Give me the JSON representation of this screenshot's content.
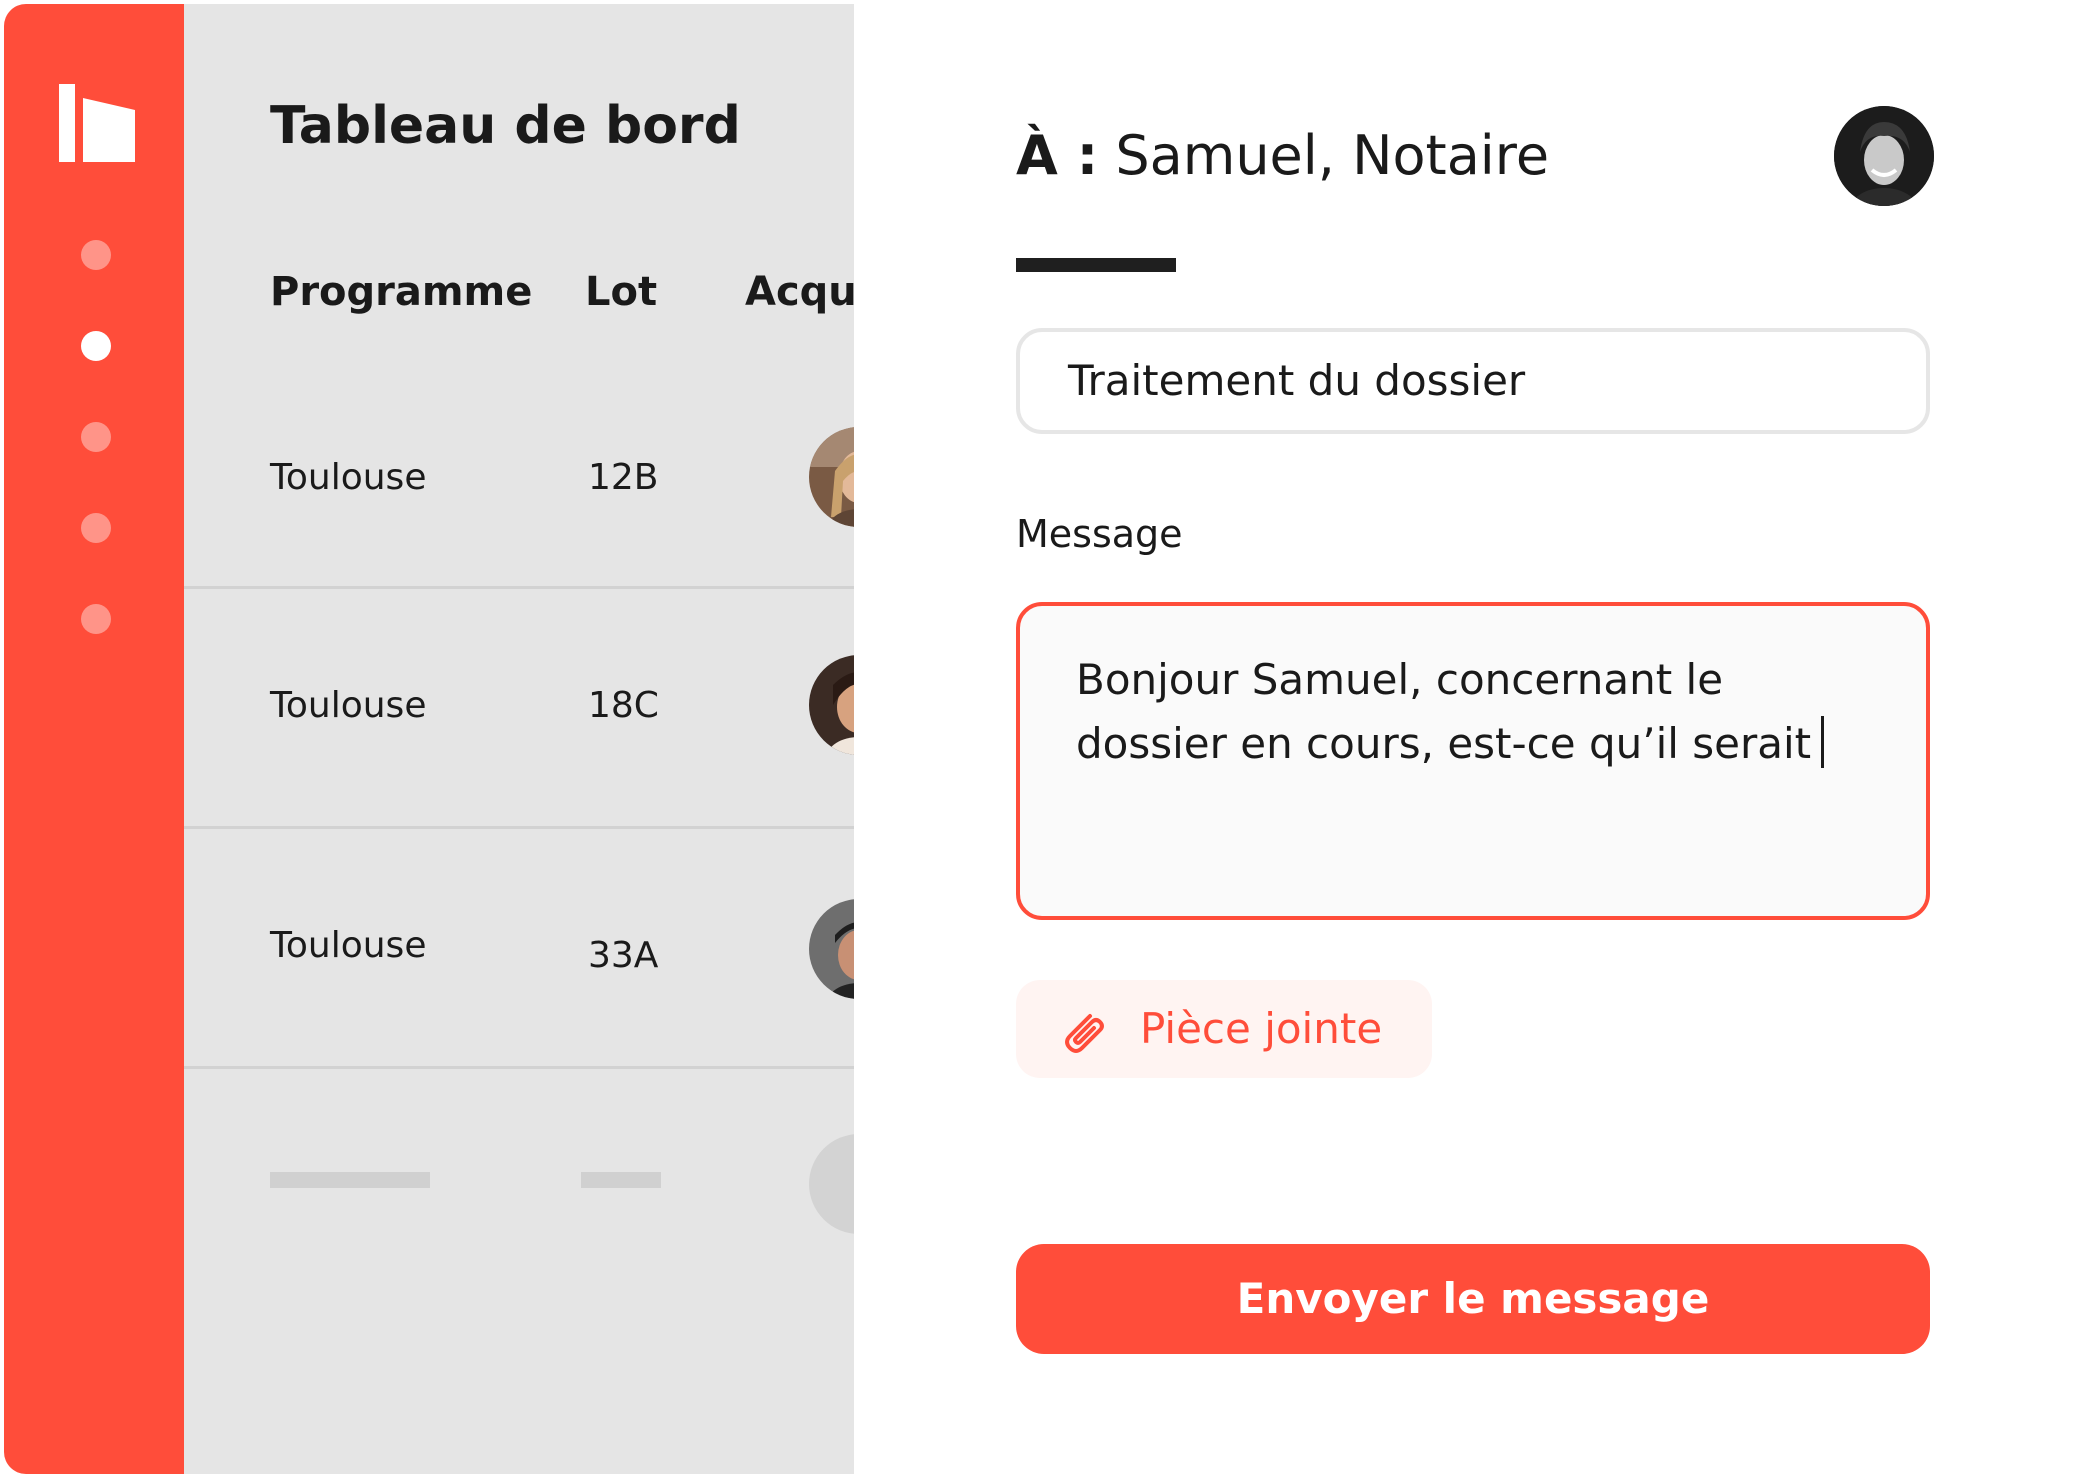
{
  "colors": {
    "brand": "#ff4d3a",
    "sidebar_dot_inactive": "#ff9488",
    "dashboard_bg": "#e5e5e5"
  },
  "sidebar": {
    "logo_icon": "building-logo-icon",
    "nav_dots": [
      {
        "icon": "nav-dot",
        "active": false
      },
      {
        "icon": "nav-dot",
        "active": true
      },
      {
        "icon": "nav-dot",
        "active": false
      },
      {
        "icon": "nav-dot",
        "active": false
      },
      {
        "icon": "nav-dot",
        "active": false
      }
    ]
  },
  "dashboard": {
    "title": "Tableau de bord",
    "columns": [
      "Programme",
      "Lot",
      "Acqu"
    ],
    "rows": [
      {
        "programme": "Toulouse",
        "lot": "12B"
      },
      {
        "programme": "Toulouse",
        "lot": "18C"
      },
      {
        "programme": "Toulouse",
        "lot": "33A"
      }
    ]
  },
  "message_panel": {
    "to_prefix": "À :",
    "to_name": "Samuel, Notaire",
    "recipient_avatar_icon": "avatar",
    "subject_value": "Traitement du dossier",
    "message_label": "Message",
    "message_line1": "Bonjour Samuel, concernant le",
    "message_line2": "dossier en cours, est-ce qu’il serait",
    "attach_label": "Pièce jointe",
    "attach_icon": "paperclip-icon",
    "send_label": "Envoyer le message"
  }
}
